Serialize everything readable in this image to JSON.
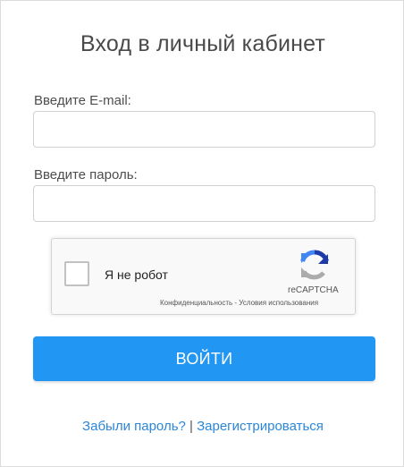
{
  "login": {
    "title": "Вход в личный кабинет",
    "email_label": "Введите E-mail:",
    "email_value": "",
    "password_label": "Введите пароль:",
    "password_value": "",
    "submit_label": "ВОЙТИ"
  },
  "captcha": {
    "label": "Я не робот",
    "brand": "reCAPTCHA",
    "privacy_link": "Конфиденциальность",
    "separator": " - ",
    "terms_link": "Условия использования",
    "icon": "recaptcha-logo-icon"
  },
  "footer": {
    "forgot_password": "Забыли пароль?",
    "separator": " | ",
    "register": "Зарегистрироваться"
  },
  "colors": {
    "primary_button": "#2196f3",
    "link": "#2b86d9",
    "title_text": "#4a4a4a"
  }
}
